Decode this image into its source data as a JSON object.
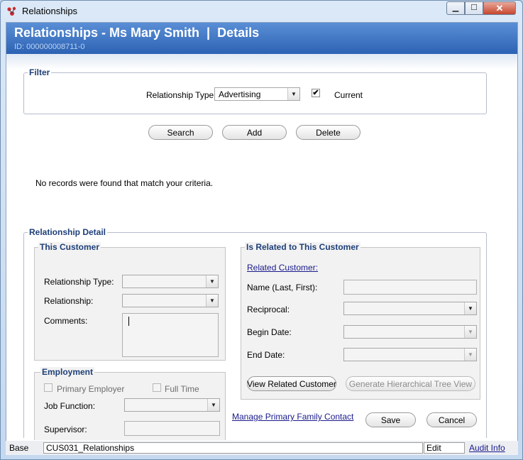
{
  "window": {
    "title": "Relationships"
  },
  "header": {
    "title": "Relationships - Ms Mary Smith  |  Details",
    "id_text": "ID: 000000008711-0"
  },
  "filter": {
    "legend": "Filter",
    "relationship_type_label": "Relationship Type",
    "relationship_type_value": "Advertising",
    "current_label": "Current",
    "current_checked": "✔"
  },
  "actions": {
    "search": "Search",
    "add": "Add",
    "delete": "Delete"
  },
  "results": {
    "empty_message": "No records were found that match your criteria."
  },
  "detail": {
    "legend": "Relationship Detail",
    "this_customer": {
      "legend": "This Customer",
      "relationship_type_label": "Relationship Type:",
      "relationship_label": "Relationship:",
      "comments_label": "Comments:"
    },
    "employment": {
      "legend": "Employment",
      "primary_employer_label": "Primary Employer",
      "full_time_label": "Full Time",
      "job_function_label": "Job Function:",
      "supervisor_label": "Supervisor:"
    },
    "related": {
      "legend": "Is Related to This Customer",
      "related_customer_link": "Related Customer:",
      "name_label": "Name (Last, First):",
      "reciprocal_label": "Reciprocal:",
      "begin_date_label": "Begin Date:",
      "end_date_label": "End Date:",
      "view_button": "View Related Customer",
      "tree_button": "Generate Hierarchical Tree View"
    },
    "manage_link": "Manage Primary Family Contact",
    "save_button": "Save",
    "cancel_button": "Cancel"
  },
  "statusbar": {
    "base": "Base",
    "form": "CUS031_Relationships",
    "mode": "Edit",
    "audit": "Audit Info"
  },
  "colors": {
    "header_band": "#2c62b3",
    "legend": "#1e3f78",
    "link": "#1a1a8c"
  }
}
